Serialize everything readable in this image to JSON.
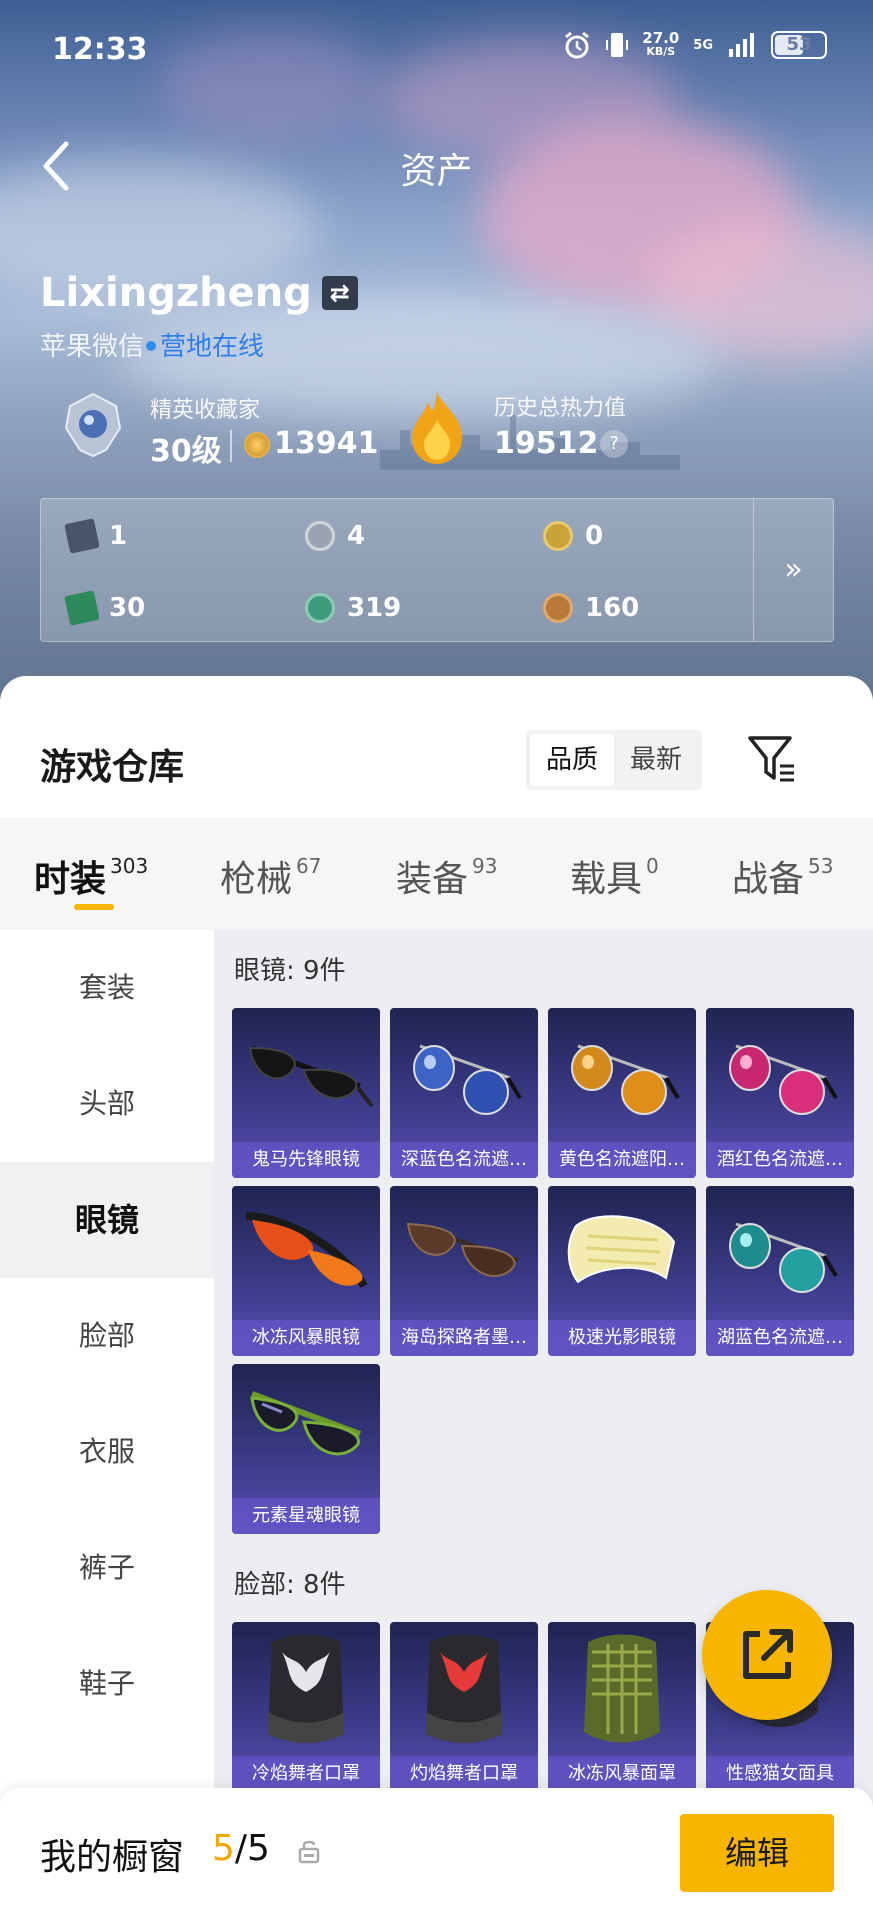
{
  "status_bar": {
    "time": "12:33",
    "net_speed": "27.0",
    "net_unit": "KB/S",
    "signal": "5G",
    "battery": "53"
  },
  "nav": {
    "title": "资产"
  },
  "profile": {
    "name": "Lixingzheng",
    "swap_icon": "⇄",
    "platform": "苹果微信",
    "status": "营地在线",
    "rank_title": "精英收藏家",
    "level": "30级",
    "coins": "13941",
    "heat_title": "历史总热力值",
    "heat_value": "19512",
    "help": "?"
  },
  "assets": {
    "items": [
      {
        "icon": "card-icon",
        "value": "1",
        "color": "#4a5468"
      },
      {
        "icon": "silver-coin-icon",
        "value": "4",
        "color": "#9aa3b0"
      },
      {
        "icon": "gold-badge-icon",
        "value": "0",
        "color": "#c9a23a"
      },
      {
        "icon": "green-card-icon",
        "value": "30",
        "color": "#2e8a5a"
      },
      {
        "icon": "green-orb-icon",
        "value": "319",
        "color": "#3d9a7a"
      },
      {
        "icon": "bronze-coin-icon",
        "value": "160",
        "color": "#b87838"
      }
    ],
    "more": "»"
  },
  "warehouse": {
    "title": "游戏仓库",
    "sort": [
      "品质",
      "最新"
    ],
    "active_sort": "品质"
  },
  "categories": [
    {
      "label": "时装",
      "count": "303"
    },
    {
      "label": "枪械",
      "count": "67"
    },
    {
      "label": "装备",
      "count": "93"
    },
    {
      "label": "载具",
      "count": "0"
    },
    {
      "label": "战备",
      "count": "53"
    }
  ],
  "sidebar": [
    "套装",
    "头部",
    "眼镜",
    "脸部",
    "衣服",
    "裤子",
    "鞋子"
  ],
  "active_sidebar": "眼镜",
  "sections": [
    {
      "title": "眼镜: 9件",
      "items": [
        "鬼马先锋眼镜",
        "深蓝色名流遮…",
        "黄色名流遮阳…",
        "酒红色名流遮…",
        "冰冻风暴眼镜",
        "海岛探路者墨…",
        "极速光影眼镜",
        "湖蓝色名流遮…",
        "元素星魂眼镜"
      ]
    },
    {
      "title": "脸部: 8件",
      "items": [
        "冷焰舞者口罩",
        "灼焰舞者口罩",
        "冰冻风暴面罩",
        "性感猫女面具"
      ]
    }
  ],
  "bottom": {
    "label": "我的橱窗",
    "current": "5",
    "total": "/5",
    "action": "编辑"
  },
  "colors": {
    "accent": "#f7b500",
    "link": "#2f7fe8",
    "card_bg": "#3a3a86"
  }
}
